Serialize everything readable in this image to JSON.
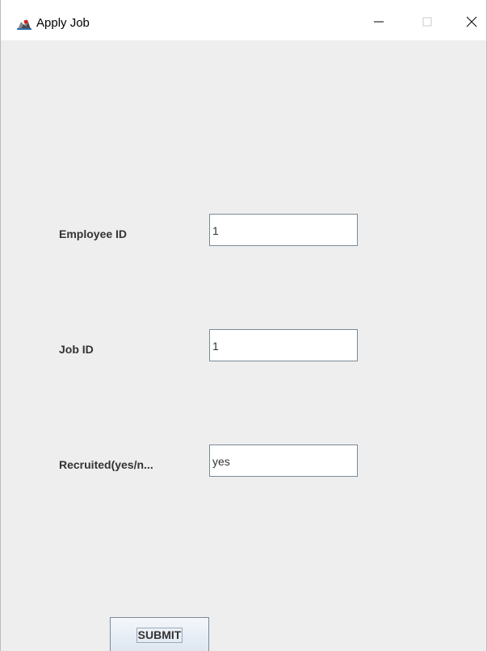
{
  "window": {
    "title": "Apply Job",
    "icon": "java-cup-icon",
    "controls": [
      "minimize-icon",
      "maximize-icon",
      "close-icon"
    ]
  },
  "form": {
    "fields": [
      {
        "label": "Employee ID",
        "value": "1"
      },
      {
        "label": "Job ID",
        "value": "1"
      },
      {
        "label": "Recruited(yes/n...",
        "value": "yes"
      }
    ],
    "submit_label": "SUBMIT"
  },
  "colors": {
    "background": "#eeeeee",
    "titlebar": "#ffffff",
    "field_border": "#7a8a99",
    "label_text": "#333333"
  }
}
